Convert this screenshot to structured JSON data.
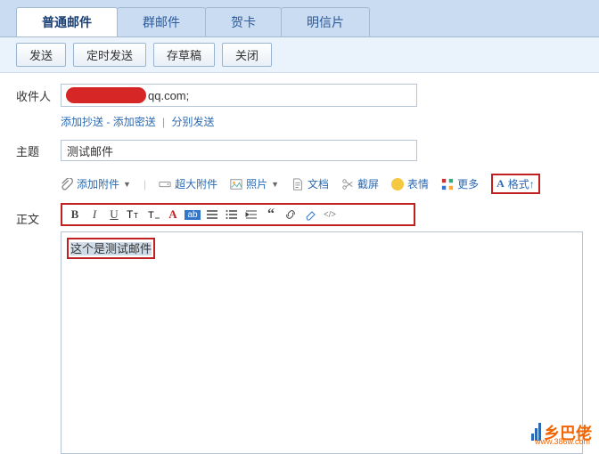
{
  "tabs": {
    "normal": "普通邮件",
    "group": "群邮件",
    "card": "贺卡",
    "postcard": "明信片"
  },
  "actions": {
    "send": "发送",
    "schedule": "定时发送",
    "draft": "存草稿",
    "close": "关闭"
  },
  "labels": {
    "recipient": "收件人",
    "subject": "主题",
    "body": "正文"
  },
  "recipient": {
    "domain": "qq.com;"
  },
  "links": {
    "cc": "添加抄送",
    "bcc": "添加密送",
    "split": "分别发送",
    "dash": " - ",
    "sep": "|"
  },
  "subject": {
    "value": "测试邮件"
  },
  "attach": {
    "add": "添加附件",
    "big": "超大附件",
    "photo": "照片",
    "doc": "文档",
    "screenshot": "截屏",
    "emoji": "表情",
    "more": "更多",
    "format": "格式↑"
  },
  "body": {
    "text": "这个是测试邮件"
  },
  "watermark": {
    "text": "乡巴佬",
    "url": "www.386w.com"
  },
  "editor": {
    "html": "</>"
  }
}
